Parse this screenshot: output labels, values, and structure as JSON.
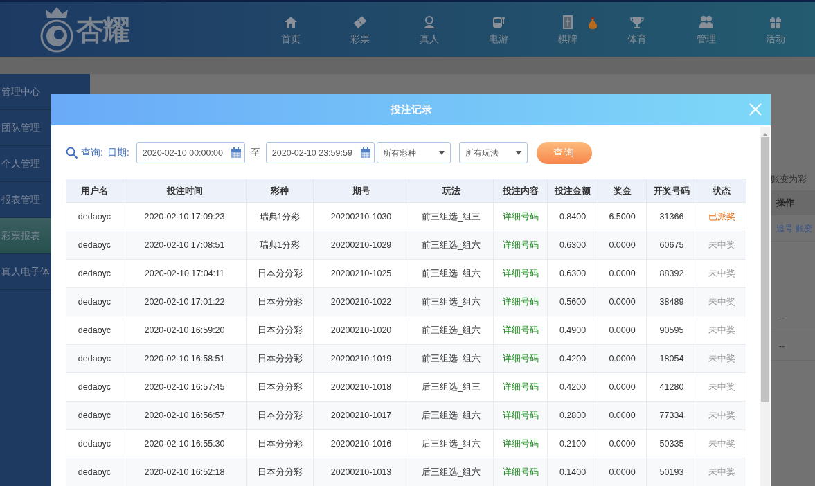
{
  "header": {
    "logo_text": "杏耀",
    "nav": [
      {
        "label": "首页",
        "kind": "home"
      },
      {
        "label": "彩票",
        "kind": "lottery"
      },
      {
        "label": "真人",
        "kind": "live"
      },
      {
        "label": "电游",
        "kind": "slots"
      },
      {
        "label": "棋牌",
        "kind": "cards"
      },
      {
        "label": "体育",
        "kind": "sports"
      },
      {
        "label": "管理",
        "kind": "admin"
      },
      {
        "label": "活动",
        "kind": "promo"
      }
    ]
  },
  "sidebar": {
    "items": [
      {
        "label": "管理中心",
        "selected": false
      },
      {
        "label": "团队管理",
        "selected": false
      },
      {
        "label": "个人管理",
        "selected": false
      },
      {
        "label": "报表管理",
        "selected": false
      },
      {
        "label": "彩票报表",
        "selected": true
      },
      {
        "label": "真人电子体",
        "selected": false
      }
    ]
  },
  "background_panel": {
    "note": "账变为彩",
    "column_header": "操作",
    "links": [
      "追号",
      "账变"
    ],
    "cells": [
      "--",
      "--"
    ]
  },
  "modal": {
    "title": "投注记录",
    "filter": {
      "search_label": "查询:",
      "date_label": "日期:",
      "start": "2020-02-10 00:00:00",
      "separator": "至",
      "end": "2020-02-10 23:59:59",
      "lottery_select": "所有彩种",
      "play_select": "所有玩法",
      "submit": "查询"
    },
    "table": {
      "columns": [
        "用户名",
        "投注时间",
        "彩种",
        "期号",
        "玩法",
        "投注内容",
        "投注金额",
        "奖金",
        "开奖号码",
        "状态"
      ],
      "rows": [
        {
          "cells": [
            "dedaoyc",
            "2020-02-10 17:09:23",
            "瑞典1分彩",
            "20200210-1030",
            "前三组选_组三",
            "详细号码",
            "0.8400",
            "6.5000",
            "31366"
          ],
          "status": {
            "text": "已派奖",
            "kind": "paid"
          }
        },
        {
          "cells": [
            "dedaoyc",
            "2020-02-10 17:08:51",
            "瑞典1分彩",
            "20200210-1029",
            "前三组选_组六",
            "详细号码",
            "0.6300",
            "0.0000",
            "60675"
          ],
          "status": {
            "text": "未中奖",
            "kind": "lost"
          }
        },
        {
          "cells": [
            "dedaoyc",
            "2020-02-10 17:04:11",
            "日本分分彩",
            "20200210-1025",
            "前三组选_组六",
            "详细号码",
            "0.6300",
            "0.0000",
            "88392"
          ],
          "status": {
            "text": "未中奖",
            "kind": "lost"
          }
        },
        {
          "cells": [
            "dedaoyc",
            "2020-02-10 17:01:22",
            "日本分分彩",
            "20200210-1022",
            "前三组选_组六",
            "详细号码",
            "0.5600",
            "0.0000",
            "38489"
          ],
          "status": {
            "text": "未中奖",
            "kind": "lost"
          }
        },
        {
          "cells": [
            "dedaoyc",
            "2020-02-10 16:59:20",
            "日本分分彩",
            "20200210-1020",
            "前三组选_组六",
            "详细号码",
            "0.4900",
            "0.0000",
            "90595"
          ],
          "status": {
            "text": "未中奖",
            "kind": "lost"
          }
        },
        {
          "cells": [
            "dedaoyc",
            "2020-02-10 16:58:51",
            "日本分分彩",
            "20200210-1019",
            "前三组选_组六",
            "详细号码",
            "0.4200",
            "0.0000",
            "18054"
          ],
          "status": {
            "text": "未中奖",
            "kind": "lost"
          }
        },
        {
          "cells": [
            "dedaoyc",
            "2020-02-10 16:57:45",
            "日本分分彩",
            "20200210-1018",
            "后三组选_组三",
            "详细号码",
            "0.4200",
            "0.0000",
            "41280"
          ],
          "status": {
            "text": "未中奖",
            "kind": "lost"
          }
        },
        {
          "cells": [
            "dedaoyc",
            "2020-02-10 16:56:57",
            "日本分分彩",
            "20200210-1017",
            "后三组选_组六",
            "详细号码",
            "0.2800",
            "0.0000",
            "77334"
          ],
          "status": {
            "text": "未中奖",
            "kind": "lost"
          }
        },
        {
          "cells": [
            "dedaoyc",
            "2020-02-10 16:55:30",
            "日本分分彩",
            "20200210-1016",
            "后三组选_组六",
            "详细号码",
            "0.2100",
            "0.0000",
            "50335"
          ],
          "status": {
            "text": "未中奖",
            "kind": "lost"
          }
        },
        {
          "cells": [
            "dedaoyc",
            "2020-02-10 16:52:18",
            "日本分分彩",
            "20200210-1013",
            "后三组选_组六",
            "详细号码",
            "0.1400",
            "0.0000",
            "50193"
          ],
          "status": {
            "text": "未中奖",
            "kind": "lost"
          }
        }
      ]
    }
  }
}
